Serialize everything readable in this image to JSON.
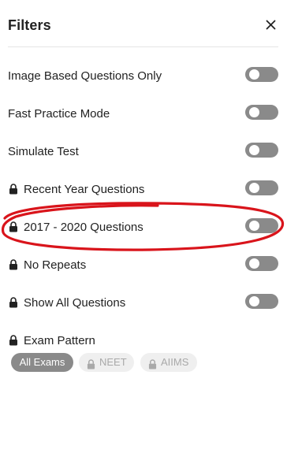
{
  "header": {
    "title": "Filters",
    "close_icon": "close-icon"
  },
  "filters": [
    {
      "label": "Image Based Questions Only",
      "locked": false,
      "enabled": false
    },
    {
      "label": "Fast Practice Mode",
      "locked": false,
      "enabled": false
    },
    {
      "label": "Simulate Test",
      "locked": false,
      "enabled": false
    },
    {
      "label": "Recent Year Questions",
      "locked": true,
      "enabled": false
    },
    {
      "label": "2017 - 2020 Questions",
      "locked": true,
      "enabled": false
    },
    {
      "label": "No Repeats",
      "locked": true,
      "enabled": false
    },
    {
      "label": "Show All Questions",
      "locked": true,
      "enabled": false
    }
  ],
  "exam_pattern": {
    "label": "Exam Pattern",
    "locked": true,
    "options": [
      {
        "label": "All Exams",
        "selected": true,
        "locked": false
      },
      {
        "label": "NEET",
        "selected": false,
        "locked": true
      },
      {
        "label": "AIIMS",
        "selected": false,
        "locked": true
      }
    ]
  },
  "colors": {
    "toggle_off": "#8a8a8a",
    "chip_active": "#8a8a8a",
    "chip_locked_bg": "#efefef",
    "chip_locked_text": "#a9a9a9",
    "annotation_ring": "#d9141b"
  },
  "icons": {
    "lock": "lock-icon",
    "close": "close-icon"
  }
}
